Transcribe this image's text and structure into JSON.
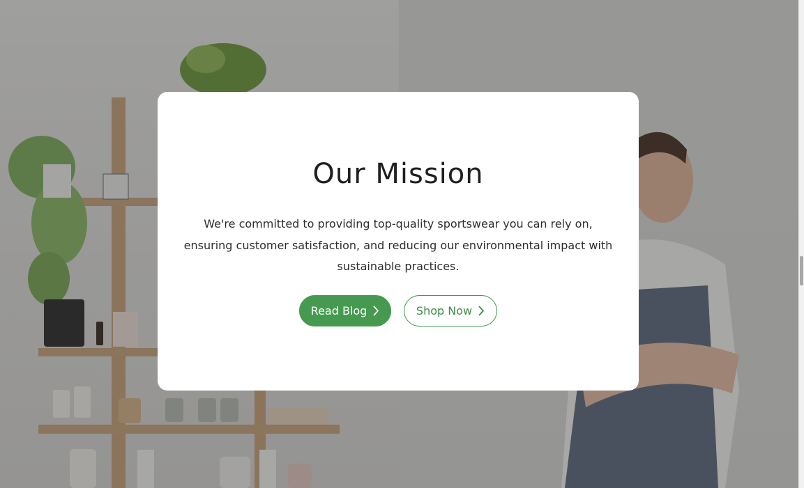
{
  "modal": {
    "title": "Our Mission",
    "body": "We're committed to providing top-quality sportswear you can rely on, ensuring customer satisfaction, and reducing our environmental impact with sustainable practices.",
    "primary_button_label": "Read Blog",
    "secondary_button_label": "Shop Now",
    "button_icon": "chevron-right-icon"
  },
  "colors": {
    "accent": "#469a4f",
    "modal_background": "#ffffff",
    "title_text": "#1f1f1f",
    "overlay": "rgba(40,40,40,0.38)"
  },
  "background": {
    "left_scene": "shop-shelves-with-plants-and-jars",
    "right_scene": "man-in-apron-with-crossed-arms"
  }
}
